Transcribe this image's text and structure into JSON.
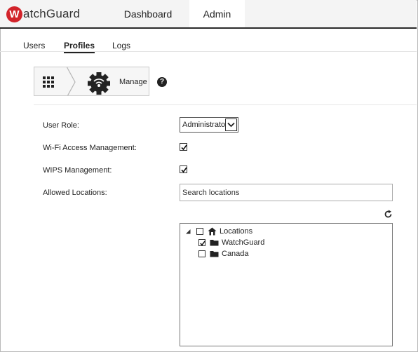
{
  "brand": {
    "logo_text": "atchGuard",
    "logo_badge": "W",
    "accent": "#d2232a"
  },
  "nav": {
    "dashboard": "Dashboard",
    "admin": "Admin"
  },
  "subtabs": {
    "users": "Users",
    "profiles": "Profiles",
    "logs": "Logs"
  },
  "breadcrumb": {
    "current": "Manage",
    "home_icon": "grid-icon",
    "page_icon": "gear-wifi-icon"
  },
  "help": {
    "glyph": "?"
  },
  "form": {
    "user_role": {
      "label": "User Role:",
      "value": "Administrator"
    },
    "wifi_access": {
      "label": "Wi-Fi Access Management:",
      "checked": true
    },
    "wips": {
      "label": "WIPS Management:",
      "checked": true
    },
    "allowed_locations": {
      "label": "Allowed Locations:",
      "placeholder": "Search locations"
    }
  },
  "tree": {
    "root": {
      "label": "Locations",
      "checked": false,
      "expanded": true
    },
    "children": [
      {
        "label": "WatchGuard",
        "checked": true
      },
      {
        "label": "Canada",
        "checked": false
      }
    ]
  }
}
